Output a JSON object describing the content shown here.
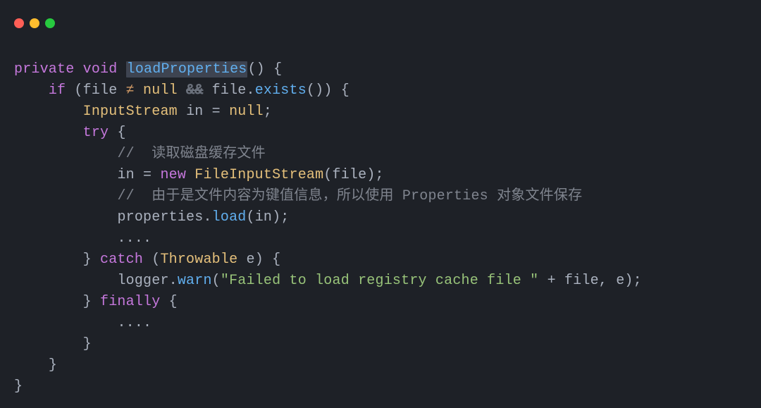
{
  "traffic_lights": [
    "red",
    "yellow",
    "green"
  ],
  "tokens": {
    "kw_private": "private",
    "kw_void": "void",
    "fn_name": "loadProperties",
    "paren_open": "(",
    "paren_close": ")",
    "brace_open": "{",
    "brace_close": "}",
    "kw_if": "if",
    "var_file": "file",
    "op_neq": "≠",
    "const_null": "null",
    "op_and_strike": "&&",
    "meth_exists": "exists",
    "dot": ".",
    "type_InputStream": "InputStream",
    "var_in": "in",
    "op_eq": "=",
    "semi": ";",
    "kw_try": "try",
    "cmt1": "//  读取磁盘缓存文件",
    "kw_new": "new",
    "type_FileInputStream": "FileInputStream",
    "cmt2": "//  由于是文件内容为键值信息，所以使用 Properties 对象文件保存",
    "var_properties": "properties",
    "meth_load": "load",
    "dots": "....",
    "kw_catch": "catch",
    "type_Throwable": "Throwable",
    "var_e": "e",
    "var_logger": "logger",
    "meth_warn": "warn",
    "str_fail": "\"Failed to load registry cache file \"",
    "op_plus": "+",
    "comma": ",",
    "kw_finally": "finally"
  }
}
